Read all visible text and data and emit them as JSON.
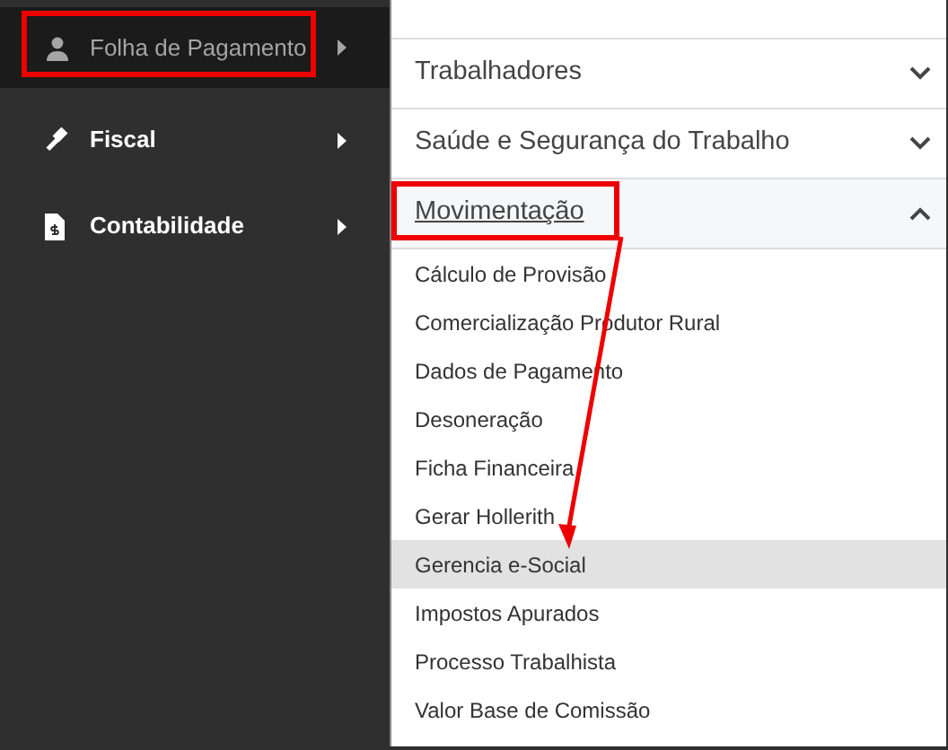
{
  "sidebar": {
    "items": [
      {
        "label": "Folha de Pagamento",
        "selected": true
      },
      {
        "label": "Fiscal",
        "selected": false
      },
      {
        "label": "Contabilidade",
        "selected": false
      }
    ]
  },
  "menu": {
    "sections": [
      {
        "title": "Trabalhadores",
        "expanded": false
      },
      {
        "title": "Saúde e Segurança do Trabalho",
        "expanded": false
      },
      {
        "title": "Movimentação",
        "expanded": true,
        "items": [
          {
            "label": "Cálculo de Provisão",
            "selected": false
          },
          {
            "label": "Comercialização Produtor Rural",
            "selected": false
          },
          {
            "label": "Dados de Pagamento",
            "selected": false
          },
          {
            "label": "Desoneração",
            "selected": false
          },
          {
            "label": "Ficha Financeira",
            "selected": false
          },
          {
            "label": "Gerar Hollerith",
            "selected": false
          },
          {
            "label": "Gerencia e-Social",
            "selected": true
          },
          {
            "label": "Impostos Apurados",
            "selected": false
          },
          {
            "label": "Processo Trabalhista",
            "selected": false
          },
          {
            "label": "Valor Base de Comissão",
            "selected": false
          }
        ]
      }
    ]
  }
}
